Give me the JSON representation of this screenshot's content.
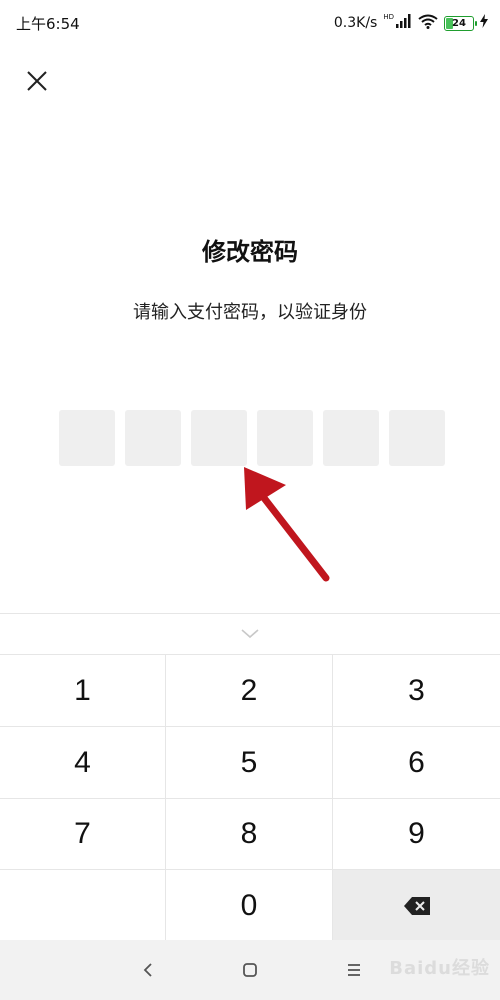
{
  "status_bar": {
    "time": "上午6:54",
    "network_speed": "0.3K/s",
    "hd_label": "HD",
    "battery_level": "24",
    "icons": [
      "signal-icon",
      "wifi-icon",
      "battery-icon",
      "charging-icon"
    ]
  },
  "header": {
    "close_icon": "close-icon"
  },
  "main": {
    "title": "修改密码",
    "subtitle": "请输入支付密码，以验证身份",
    "pin_length": 6,
    "pin_filled": 0
  },
  "keypad": {
    "collapse_icon": "chevron-down-icon",
    "keys": [
      "1",
      "2",
      "3",
      "4",
      "5",
      "6",
      "7",
      "8",
      "9",
      "",
      "0",
      "⌫"
    ],
    "delete_icon": "backspace-icon"
  },
  "nav_bar": {
    "icons": [
      "back-icon",
      "home-icon",
      "menu-icon"
    ],
    "watermark": "Baidu经验"
  },
  "colors": {
    "pin_box": "#efefef",
    "arrow": "#c0161e",
    "battery_border": "#1f9d2e",
    "delete_key_bg": "#ececec",
    "nav_bg": "#f2f2f2"
  }
}
